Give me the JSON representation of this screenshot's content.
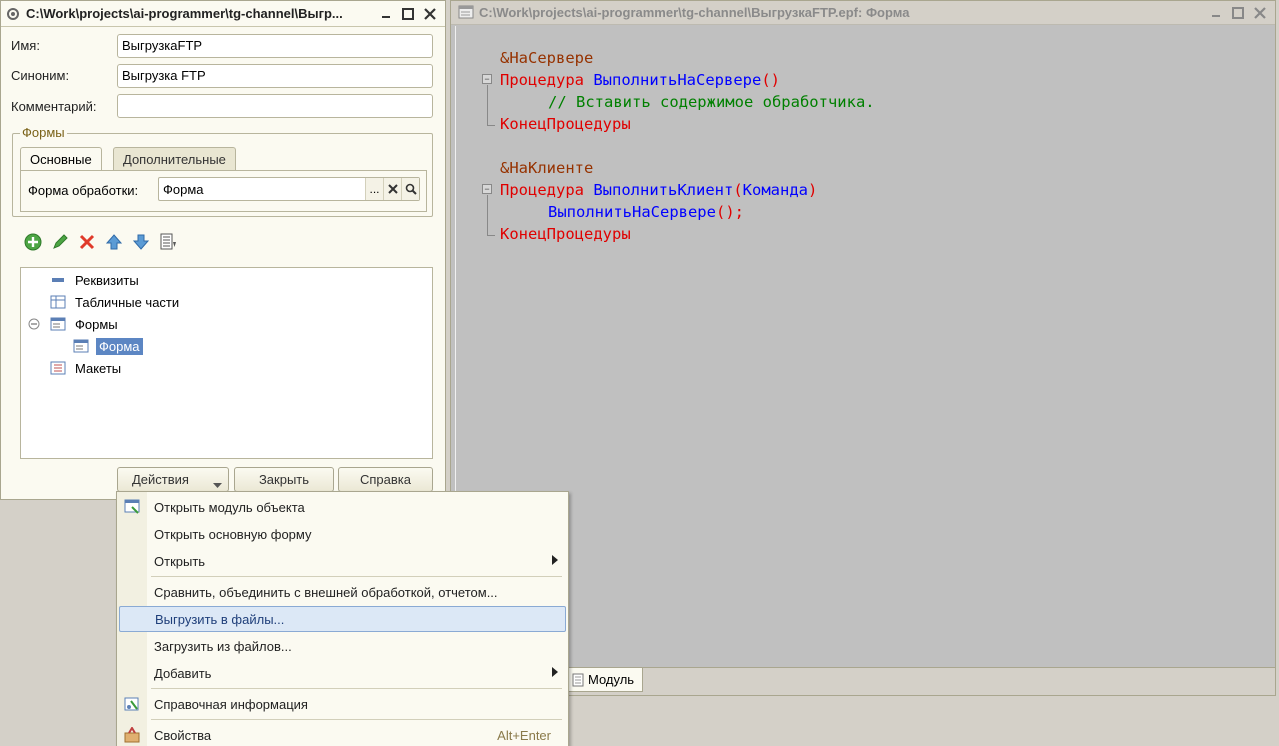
{
  "props_window": {
    "title": "C:\\Work\\projects\\ai-programmer\\tg-channel\\Выгр...",
    "name_label": "Имя:",
    "name_value": "ВыгрузкаFTP",
    "synonym_label": "Синоним:",
    "synonym_value": "Выгрузка FTP",
    "comment_label": "Комментарий:",
    "comment_value": "",
    "forms_group": "Формы",
    "tabs": [
      "Основные",
      "Дополнительные"
    ],
    "form_label": "Форма обработки:",
    "form_value": "Форма",
    "form_btn_select": "...",
    "tree": [
      "Реквизиты",
      "Табличные части",
      "Формы",
      "Форма",
      "Макеты"
    ],
    "buttons": {
      "actions": "Действия",
      "close": "Закрыть",
      "help": "Справка"
    }
  },
  "code_window": {
    "title": "C:\\Work\\projects\\ai-programmer\\tg-channel\\ВыгрузкаFTP.epf: Форма",
    "tab_module": "Модуль",
    "code": {
      "l1": "&НаСервере",
      "l2_kw": "Процедура",
      "l2_id": "ВыполнитьНаСервере",
      "l2_paren": "()",
      "l3": "// Вставить содержимое обработчика.",
      "l4": "КонецПроцедуры",
      "l5": "&НаКлиенте",
      "l6_kw": "Процедура",
      "l6_id": "ВыполнитьКлиент",
      "l6_open": "(",
      "l6_arg": "Команда",
      "l6_close": ")",
      "l7_id": "ВыполнитьНаСервере",
      "l7_tail": "();",
      "l8": "КонецПроцедуры"
    }
  },
  "context_menu": {
    "items": [
      "Открыть модуль объекта",
      "Открыть основную форму",
      "Открыть",
      "Сравнить, объединить с внешней обработкой, отчетом...",
      "Выгрузить в файлы...",
      "Загрузить из файлов...",
      "Добавить",
      "Справочная информация",
      "Свойства"
    ],
    "shortcut_properties": "Alt+Enter",
    "highlighted": "Выгрузить в файлы..."
  },
  "colors": {
    "selection": "#5c86c3",
    "keyword": "#e00000",
    "identifier": "#0000ff",
    "comment": "#008000",
    "directive": "#963200"
  }
}
